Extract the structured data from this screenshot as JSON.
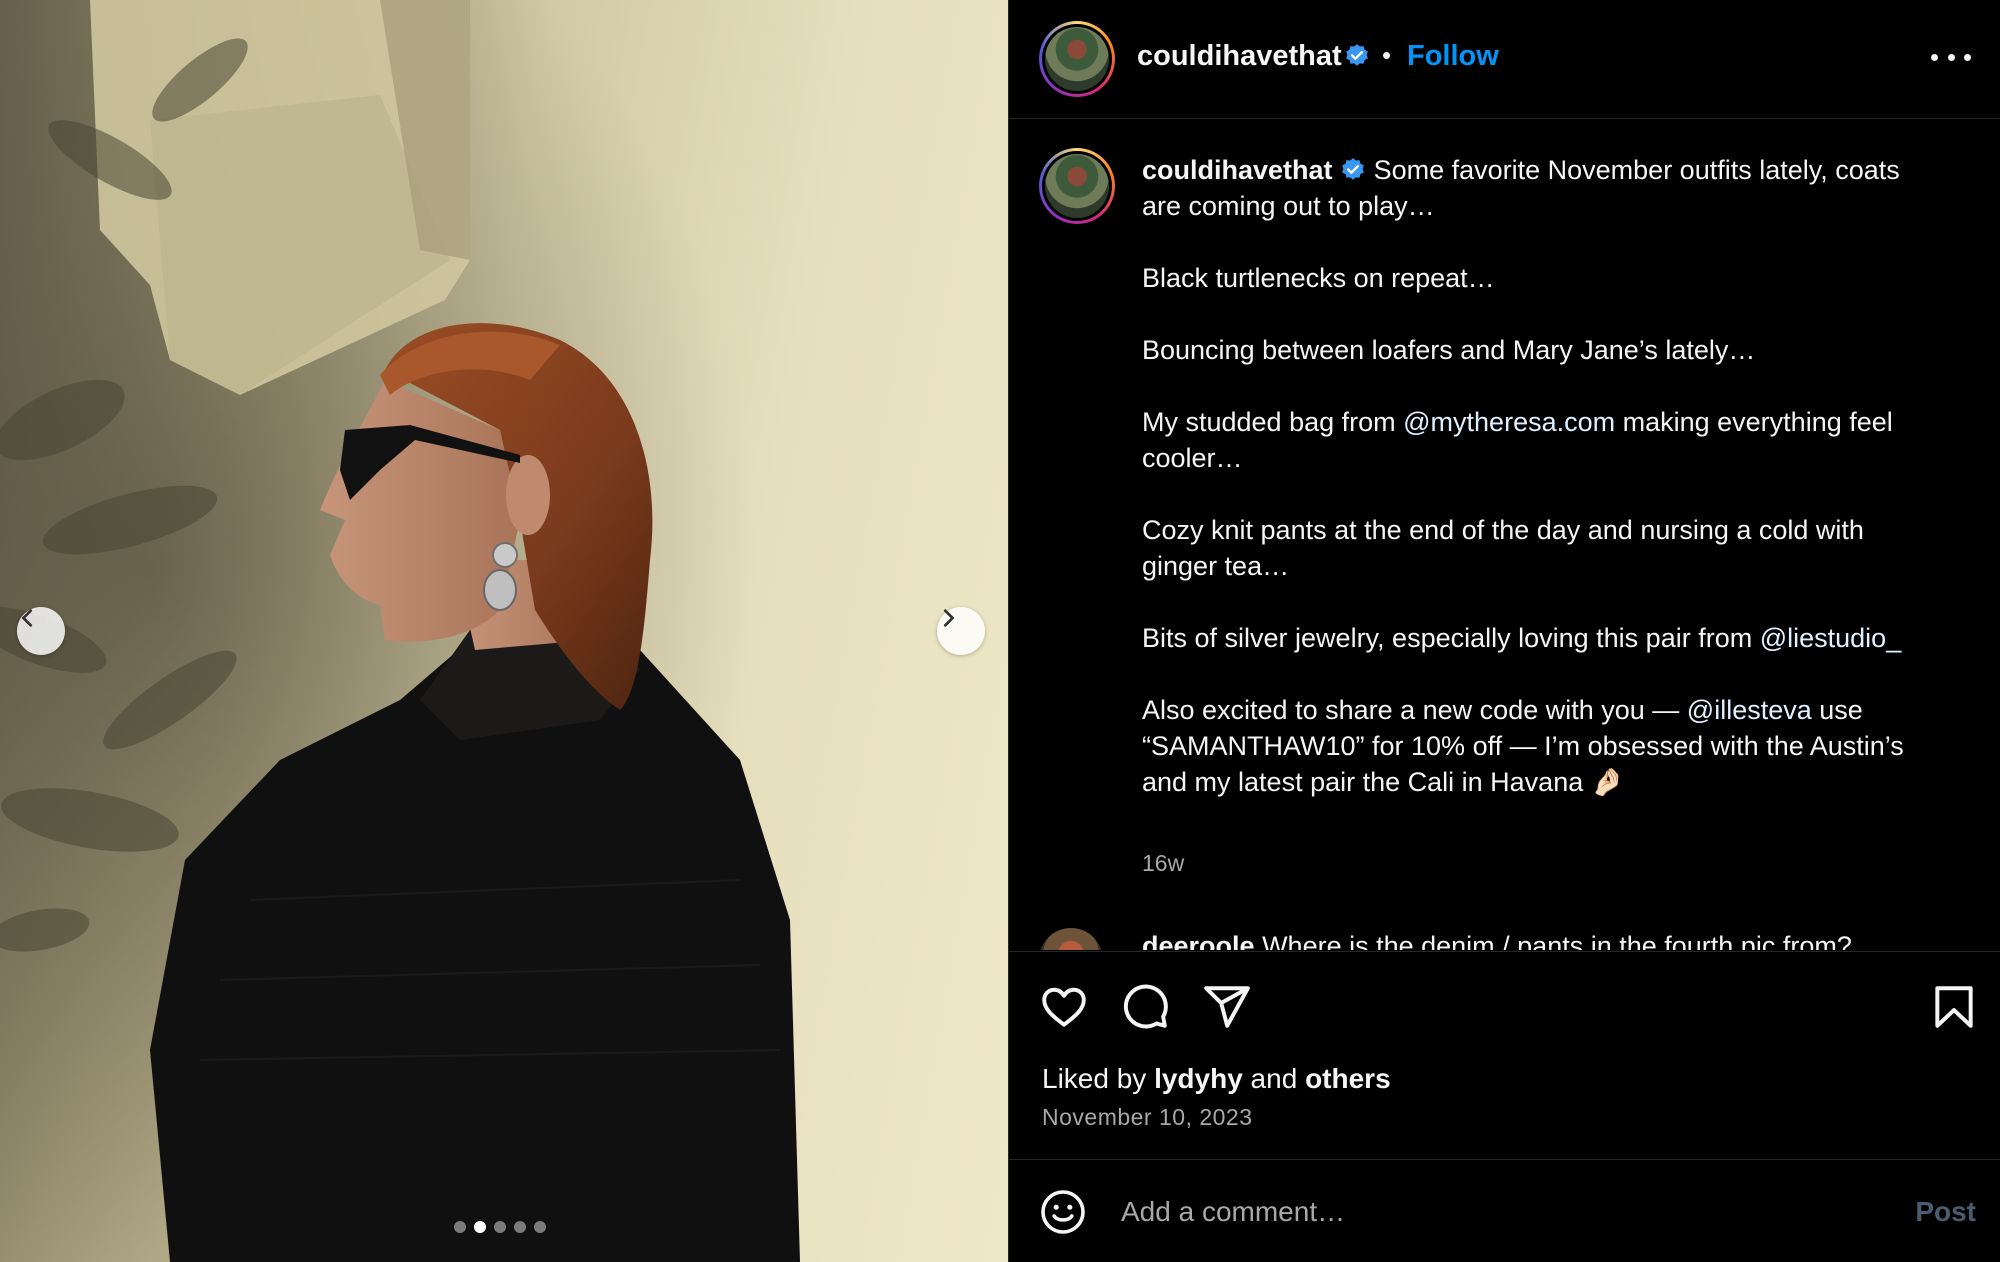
{
  "photo": {
    "prev_icon": "chevron-left-icon",
    "next_icon": "chevron-right-icon",
    "carousel_total": 5,
    "carousel_active": 2
  },
  "header": {
    "username": "couldihavethat",
    "separator": "•",
    "follow_label": "Follow",
    "more_icon": "more-horizontal-icon",
    "verified_icon": "verified-badge-icon"
  },
  "caption": {
    "username": "couldihavethat",
    "paragraphs": [
      "Some favorite November outfits lately, coats are coming out to play…",
      "Black turtlenecks on repeat…",
      "Bouncing between loafers and Mary Jane’s lately…"
    ],
    "p4_pre": "My studded bag from ",
    "p4_mention": "@mytheresa.com",
    "p4_post": " making everything feel cooler…",
    "p5": "Cozy knit pants at the end of the day and nursing a cold with ginger tea…",
    "p6_pre": "Bits of silver jewelry, especially loving this pair from ",
    "p6_mention": "@liestudio_",
    "p7_pre": "Also excited to share a new code with you — ",
    "p7_mention": "@illesteva",
    "p7_post": " use “SAMANTHAW10” for 10% off — I’m obsessed with the Austin’s and my latest pair the Cali in Havana 🤌🏻",
    "time": "16w"
  },
  "next_comment": {
    "username": "deeroole",
    "text": "Where is the denim / pants in the fourth pic from?"
  },
  "actions": {
    "like_icon": "heart-icon",
    "comment_icon": "comment-bubble-icon",
    "share_icon": "paper-plane-icon",
    "save_icon": "bookmark-icon",
    "liked_prefix": "Liked by ",
    "liked_user": "lydyhy",
    "liked_and": " and ",
    "liked_others": "others",
    "date": "November 10, 2023"
  },
  "comment_bar": {
    "emoji_icon": "smiley-icon",
    "placeholder": "Add a comment…",
    "post_label": "Post"
  },
  "colors": {
    "accent": "#0095f6",
    "background": "#000000",
    "secondary_text": "#a8a8a8",
    "divider": "#262626"
  }
}
